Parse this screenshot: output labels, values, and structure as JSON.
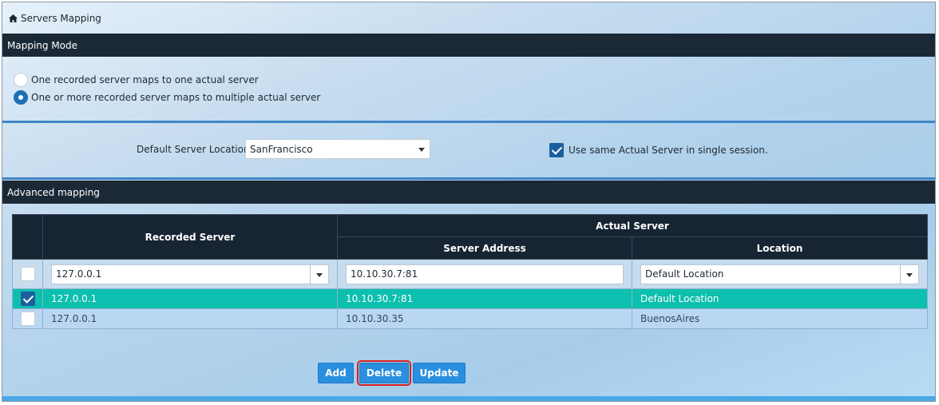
{
  "titlebar": {
    "icon": "home-icon",
    "title": "Servers Mapping"
  },
  "mapping_mode": {
    "header": "Mapping Mode",
    "options": [
      {
        "label": "One recorded server maps to one actual server",
        "selected": false
      },
      {
        "label": "One or more recorded server maps to multiple actual server",
        "selected": true
      }
    ]
  },
  "defaults": {
    "location_label": "Default Server Location",
    "location_value": "SanFrancisco",
    "same_server_label": "Use same Actual Server in single session.",
    "same_server_checked": true
  },
  "advanced": {
    "header": "Advanced mapping",
    "columns": {
      "recorded": "Recorded Server",
      "actual": "Actual Server",
      "address": "Server Address",
      "location": "Location"
    },
    "edit_row": {
      "checked": false,
      "recorded": "127.0.0.1",
      "address": "10.10.30.7:81",
      "location": "Default Location"
    },
    "rows": [
      {
        "checked": true,
        "recorded": "127.0.0.1",
        "address": "10.10.30.7:81",
        "location": "Default Location"
      },
      {
        "checked": false,
        "recorded": "127.0.0.1",
        "address": "10.10.30.35",
        "location": "BuenosAires"
      }
    ]
  },
  "buttons": {
    "add": "Add",
    "delete": "Delete",
    "update": "Update"
  },
  "colors": {
    "header_bg": "#1b2836",
    "selected_row": "#0dbfae",
    "button": "#2b8fe0",
    "highlight": "#d6201f"
  }
}
